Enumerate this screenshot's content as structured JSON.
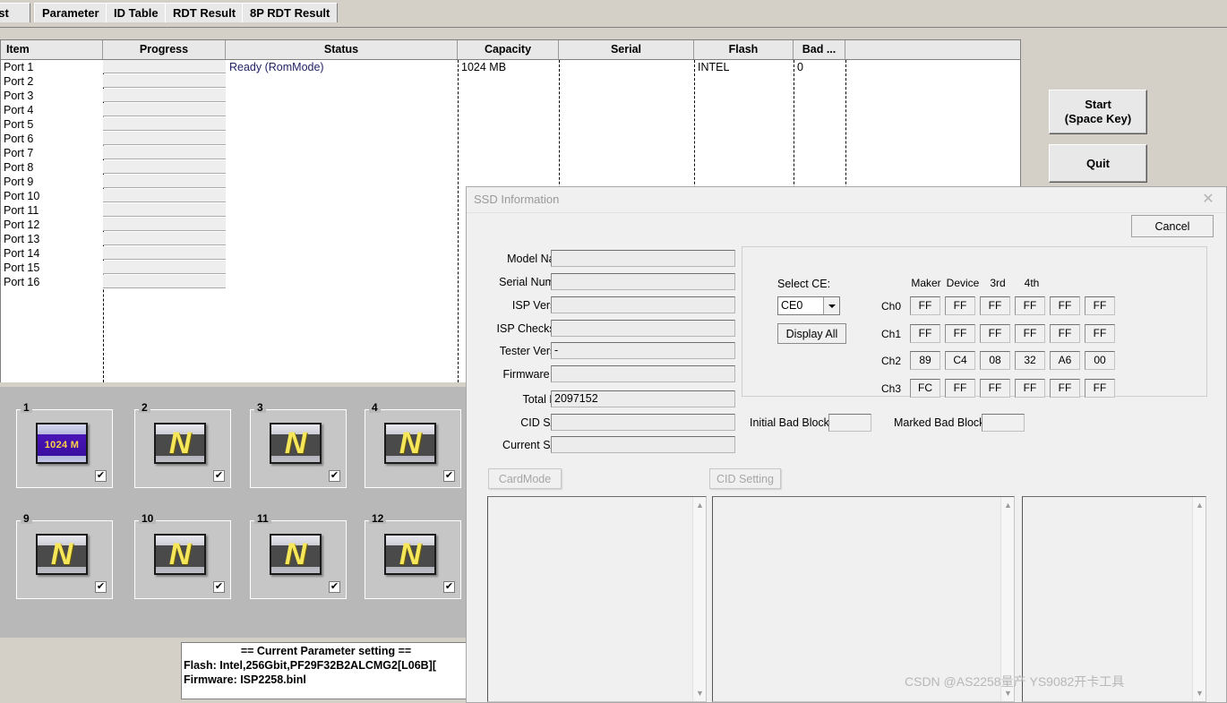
{
  "app": {
    "tabs": [
      {
        "label": "est",
        "truncated": true
      },
      {
        "label": "Parameter"
      },
      {
        "label": "ID Table"
      },
      {
        "label": "RDT Result"
      },
      {
        "label": "8P RDT Result"
      }
    ],
    "grid": {
      "columns": [
        "Item",
        "Progress",
        "Status",
        "Capacity",
        "Serial",
        "Flash",
        "Bad ..."
      ],
      "rows": [
        {
          "item": "Port 1",
          "progress": "",
          "status": "Ready (RomMode)",
          "capacity": "1024 MB",
          "serial": "",
          "flash": "INTEL",
          "bad": "0"
        },
        {
          "item": "Port 2",
          "progress": "",
          "status": "",
          "capacity": "",
          "serial": "",
          "flash": "",
          "bad": ""
        },
        {
          "item": "Port 3",
          "progress": "",
          "status": "",
          "capacity": "",
          "serial": "",
          "flash": "",
          "bad": ""
        },
        {
          "item": "Port 4",
          "progress": "",
          "status": "",
          "capacity": "",
          "serial": "",
          "flash": "",
          "bad": ""
        },
        {
          "item": "Port 5",
          "progress": "",
          "status": "",
          "capacity": "",
          "serial": "",
          "flash": "",
          "bad": ""
        },
        {
          "item": "Port 6",
          "progress": "",
          "status": "",
          "capacity": "",
          "serial": "",
          "flash": "",
          "bad": ""
        },
        {
          "item": "Port 7",
          "progress": "",
          "status": "",
          "capacity": "",
          "serial": "",
          "flash": "",
          "bad": ""
        },
        {
          "item": "Port 8",
          "progress": "",
          "status": "",
          "capacity": "",
          "serial": "",
          "flash": "",
          "bad": ""
        },
        {
          "item": "Port 9",
          "progress": "",
          "status": "",
          "capacity": "",
          "serial": "",
          "flash": "",
          "bad": ""
        },
        {
          "item": "Port 10",
          "progress": "",
          "status": "",
          "capacity": "",
          "serial": "",
          "flash": "",
          "bad": ""
        },
        {
          "item": "Port 11",
          "progress": "",
          "status": "",
          "capacity": "",
          "serial": "",
          "flash": "",
          "bad": ""
        },
        {
          "item": "Port 12",
          "progress": "",
          "status": "",
          "capacity": "",
          "serial": "",
          "flash": "",
          "bad": ""
        },
        {
          "item": "Port 13",
          "progress": "",
          "status": "",
          "capacity": "",
          "serial": "",
          "flash": "",
          "bad": ""
        },
        {
          "item": "Port 14",
          "progress": "",
          "status": "",
          "capacity": "",
          "serial": "",
          "flash": "",
          "bad": ""
        },
        {
          "item": "Port 15",
          "progress": "",
          "status": "",
          "capacity": "",
          "serial": "",
          "flash": "",
          "bad": ""
        },
        {
          "item": "Port 16",
          "progress": "",
          "status": "",
          "capacity": "",
          "serial": "",
          "flash": "",
          "bad": ""
        }
      ]
    },
    "buttons": {
      "start_line1": "Start",
      "start_line2": "(Space Key)",
      "quit": "Quit"
    },
    "tiles": [
      {
        "num": "1",
        "icon": "capacity",
        "caption": "1024 M",
        "checked": "✔"
      },
      {
        "num": "2",
        "icon": "none",
        "caption": "N",
        "checked": "✔"
      },
      {
        "num": "3",
        "icon": "none",
        "caption": "N",
        "checked": "✔"
      },
      {
        "num": "4",
        "icon": "none",
        "caption": "N",
        "checked": "✔"
      },
      {
        "num": "9",
        "icon": "none",
        "caption": "N",
        "checked": "✔"
      },
      {
        "num": "10",
        "icon": "none",
        "caption": "N",
        "checked": "✔"
      },
      {
        "num": "11",
        "icon": "none",
        "caption": "N",
        "checked": "✔"
      },
      {
        "num": "12",
        "icon": "none",
        "caption": "N",
        "checked": "✔"
      }
    ],
    "parameter_box": {
      "title": "== Current Parameter setting ==",
      "flash": "Flash:   Intel,256Gbit,PF29F32B2ALCMG2[L06B][",
      "firmware": "Firmware:   ISP2258.binl"
    }
  },
  "dialog": {
    "title": "SSD Information",
    "close_label": "✕",
    "cancel_label": "Cancel",
    "fields": [
      {
        "label": "Model Name",
        "value": ""
      },
      {
        "label": "Serial Number",
        "value": ""
      },
      {
        "label": "ISP Version",
        "value": ""
      },
      {
        "label": "ISP Checksum",
        "value": ""
      },
      {
        "label": "Tester Version",
        "value": "-"
      },
      {
        "label": "Firmware Tag",
        "value": ""
      },
      {
        "label": "Total LBA",
        "value": "2097152"
      },
      {
        "label": "CID SATA",
        "value": ""
      },
      {
        "label": "Current SATA",
        "value": ""
      }
    ],
    "ce": {
      "select_label": "Select CE:",
      "selected": "CE0",
      "display_all_label": "Display All",
      "column_headers": [
        "Maker",
        "Device",
        "3rd",
        "4th"
      ],
      "row_headers": [
        "Ch0",
        "Ch1",
        "Ch2",
        "Ch3"
      ],
      "values": [
        [
          "FF",
          "FF",
          "FF",
          "FF",
          "FF",
          "FF"
        ],
        [
          "FF",
          "FF",
          "FF",
          "FF",
          "FF",
          "FF"
        ],
        [
          "89",
          "C4",
          "08",
          "32",
          "A6",
          "00"
        ],
        [
          "FC",
          "FF",
          "FF",
          "FF",
          "FF",
          "FF"
        ]
      ]
    },
    "bad_block": {
      "initial_label": "Initial Bad Block",
      "initial_value": "",
      "marked_label": "Marked Bad Block",
      "marked_value": ""
    },
    "actions": {
      "card_mode": "CardMode",
      "cid_setting": "CID Setting"
    }
  },
  "watermark": "CSDN @AS2258量产 YS9082开卡工具",
  "colors": {
    "window_bg": "#d4d0c8",
    "dialog_bg": "#f0f0f0",
    "status_text": "#222266",
    "tile_letter": "#f5e65a",
    "tile_capacity_band": "#3a0fa0"
  }
}
